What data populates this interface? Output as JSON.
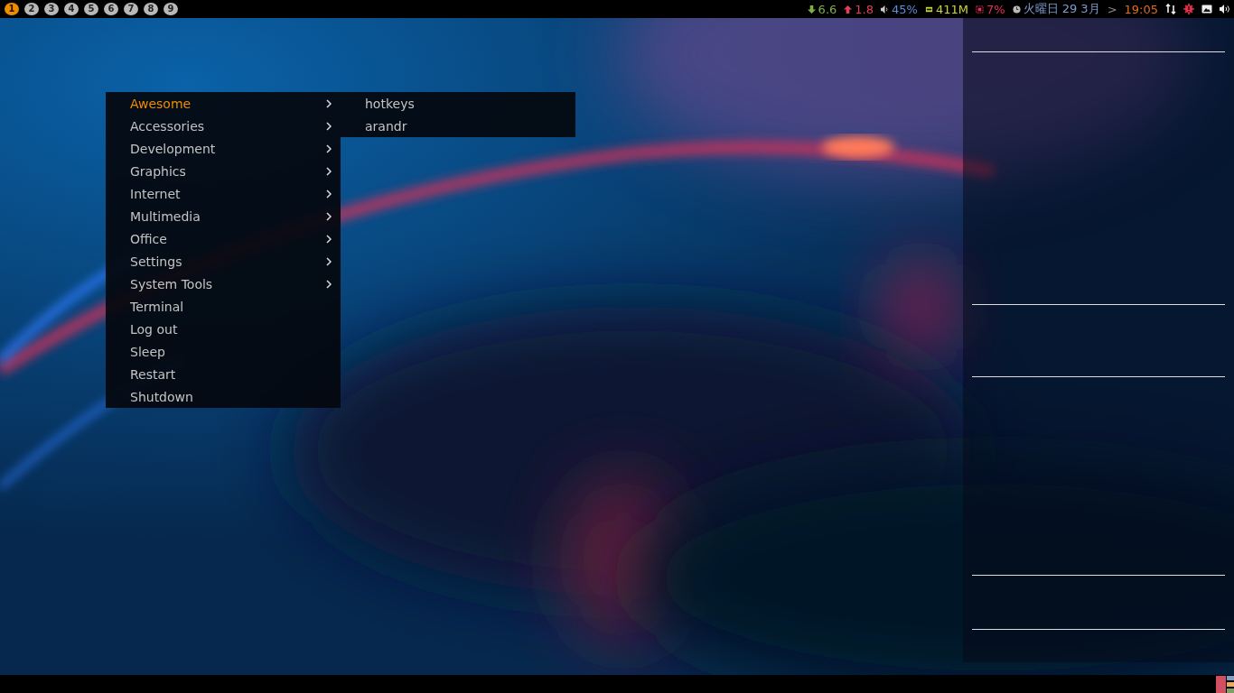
{
  "tags": [
    {
      "label": "1",
      "selected": true
    },
    {
      "label": "2",
      "selected": false
    },
    {
      "label": "3",
      "selected": false
    },
    {
      "label": "4",
      "selected": false
    },
    {
      "label": "5",
      "selected": false
    },
    {
      "label": "6",
      "selected": false
    },
    {
      "label": "7",
      "selected": false
    },
    {
      "label": "8",
      "selected": false
    },
    {
      "label": "9",
      "selected": false
    }
  ],
  "status": [
    {
      "kind": "download",
      "text": "6.6",
      "color": "#7fae45"
    },
    {
      "kind": "upload",
      "text": "1.8",
      "color": "#e0405a"
    },
    {
      "kind": "volume",
      "text": "45%",
      "color": "#5b8fdc"
    },
    {
      "kind": "memory",
      "text": "411M",
      "color": "#cbd43a"
    },
    {
      "kind": "cpu",
      "text": "7%",
      "color": "#e8305a"
    },
    {
      "kind": "date",
      "text": "火曜日 29 3月",
      "color": "#7d9bd0"
    },
    {
      "kind": "separator",
      "text": ">",
      "color": "#8a8a8a"
    },
    {
      "kind": "time",
      "text": "19:05",
      "color": "#e06a1e"
    }
  ],
  "menu": [
    {
      "label": "Awesome",
      "submenu": true,
      "selected": true
    },
    {
      "label": "Accessories",
      "submenu": true,
      "selected": false
    },
    {
      "label": "Development",
      "submenu": true,
      "selected": false
    },
    {
      "label": "Graphics",
      "submenu": true,
      "selected": false
    },
    {
      "label": "Internet",
      "submenu": true,
      "selected": false
    },
    {
      "label": "Multimedia",
      "submenu": true,
      "selected": false
    },
    {
      "label": "Office",
      "submenu": true,
      "selected": false
    },
    {
      "label": "Settings",
      "submenu": true,
      "selected": false
    },
    {
      "label": "System Tools",
      "submenu": true,
      "selected": false
    },
    {
      "label": "Terminal",
      "submenu": false,
      "selected": false
    },
    {
      "label": "Log out",
      "submenu": false,
      "selected": false
    },
    {
      "label": "Sleep",
      "submenu": false,
      "selected": false
    },
    {
      "label": "Restart",
      "submenu": false,
      "selected": false
    },
    {
      "label": "Shutdown",
      "submenu": false,
      "selected": false
    }
  ],
  "submenu": [
    {
      "label": "hotkeys"
    },
    {
      "label": "arandr"
    }
  ]
}
